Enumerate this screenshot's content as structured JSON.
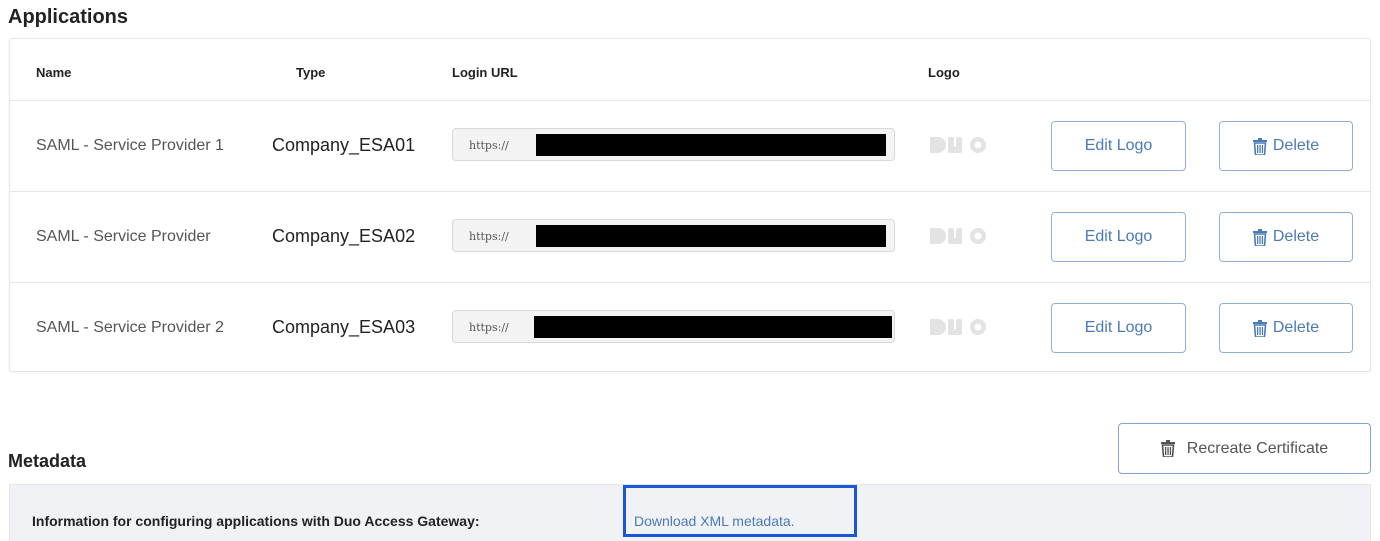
{
  "applications": {
    "title": "Applications",
    "columns": {
      "name": "Name",
      "type": "Type",
      "login_url": "Login URL",
      "logo": "Logo"
    },
    "rows": [
      {
        "name": "SAML - Service Provider 1",
        "type": "Company_ESA01",
        "url_prefix": "https://",
        "logo": "duo-logo",
        "edit_label": "Edit Logo",
        "delete_label": "Delete"
      },
      {
        "name": "SAML - Service Provider",
        "type": "Company_ESA02",
        "url_prefix": "https://",
        "logo": "duo-logo",
        "edit_label": "Edit Logo",
        "delete_label": "Delete"
      },
      {
        "name": "SAML - Service Provider 2",
        "type": "Company_ESA03",
        "url_prefix": "https://",
        "logo": "duo-logo",
        "edit_label": "Edit Logo",
        "delete_label": "Delete"
      }
    ]
  },
  "metadata": {
    "title": "Metadata",
    "recreate_label": "Recreate Certificate",
    "info_text": "Information for configuring applications with Duo Access Gateway:",
    "download_link": "Download XML metadata."
  },
  "colors": {
    "button_border": "#8fb1d9",
    "link_text": "#4a7ab8",
    "highlight_box": "#1a56d6",
    "redaction": "#000000"
  },
  "icons": {
    "delete": "trash-icon",
    "logo": "duo-logo"
  }
}
